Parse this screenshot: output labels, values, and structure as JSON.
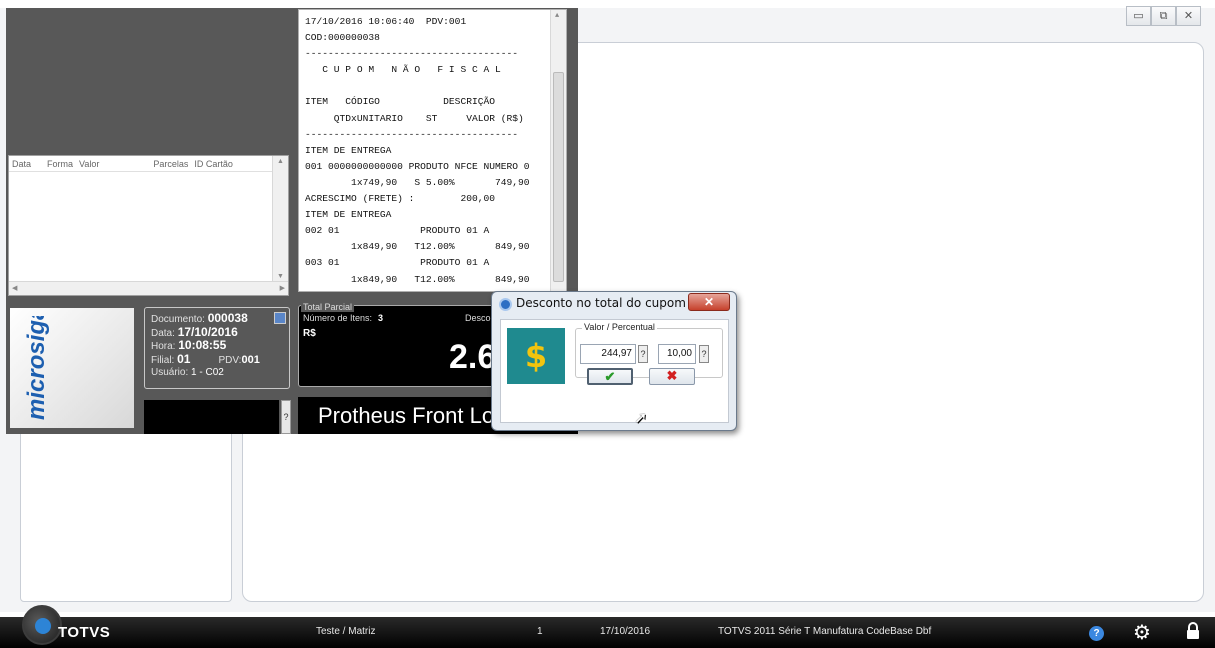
{
  "window_controls": {
    "minimize": "▭",
    "restore": "⧉",
    "close": "✕"
  },
  "payments": {
    "columns": [
      "Data",
      "Forma",
      "Valor",
      "Parcelas",
      "ID Cartão"
    ]
  },
  "logo": {
    "text": "microsiga"
  },
  "document": {
    "doc_label": "Documento:",
    "doc_value": "000038",
    "date_label": "Data:",
    "date_value": "17/10/2016",
    "time_label": "Hora:",
    "time_value": "10:08:55",
    "branch_label": "Filial:",
    "branch_value": "01",
    "pdv_label": "PDV:",
    "pdv_value": "001",
    "user_label": "Usuário:",
    "user_value": "1 - C02"
  },
  "help_button": "?",
  "receipt": {
    "lines": [
      "17/10/2016 10:06:40  PDV:001",
      "COD:000000038",
      "-------------------------------------",
      "   C U P O M   N Ã O   F I S C A L",
      "",
      "ITEM   CÓDIGO           DESCRIÇÃO",
      "     QTDxUNITARIO    ST     VALOR (R$)",
      "-------------------------------------",
      "ITEM DE ENTREGA",
      "001 0000000000000 PRODUTO NFCE NUMERO 0",
      "        1x749,90   S 5.00%       749,90",
      "ACRESCIMO (FRETE) :        200,00",
      "ITEM DE ENTREGA",
      "002 01              PRODUTO 01 A",
      "        1x849,90   T12.00%       849,90",
      "003 01              PRODUTO 01 A",
      "        1x849,90   T12.00%       849,90"
    ]
  },
  "total": {
    "legend": "Total Parcial",
    "items_label": "Número de Itens:",
    "items_value": "3",
    "desc_label": "Desco",
    "currency": "R$",
    "value": "2.6"
  },
  "banner": {
    "text": "Protheus Front Loja"
  },
  "dialog": {
    "title": "Desconto no total do cupom",
    "close": "✕",
    "group_label": "Valor / Percentual",
    "value": "244,97",
    "percent": "10,00",
    "q": "?",
    "ok": "✔",
    "cancel": "✖"
  },
  "taskbar": {
    "brand": "TOTVS",
    "company": "Teste / Matriz",
    "number": "1",
    "date": "17/10/2016",
    "product": "TOTVS 2011 Série T Manufatura CodeBase Dbf"
  },
  "colors": {
    "accent": "#2d84d6",
    "pdv_bg": "#585858",
    "dialog_icon_bg": "#1f8a8f"
  }
}
